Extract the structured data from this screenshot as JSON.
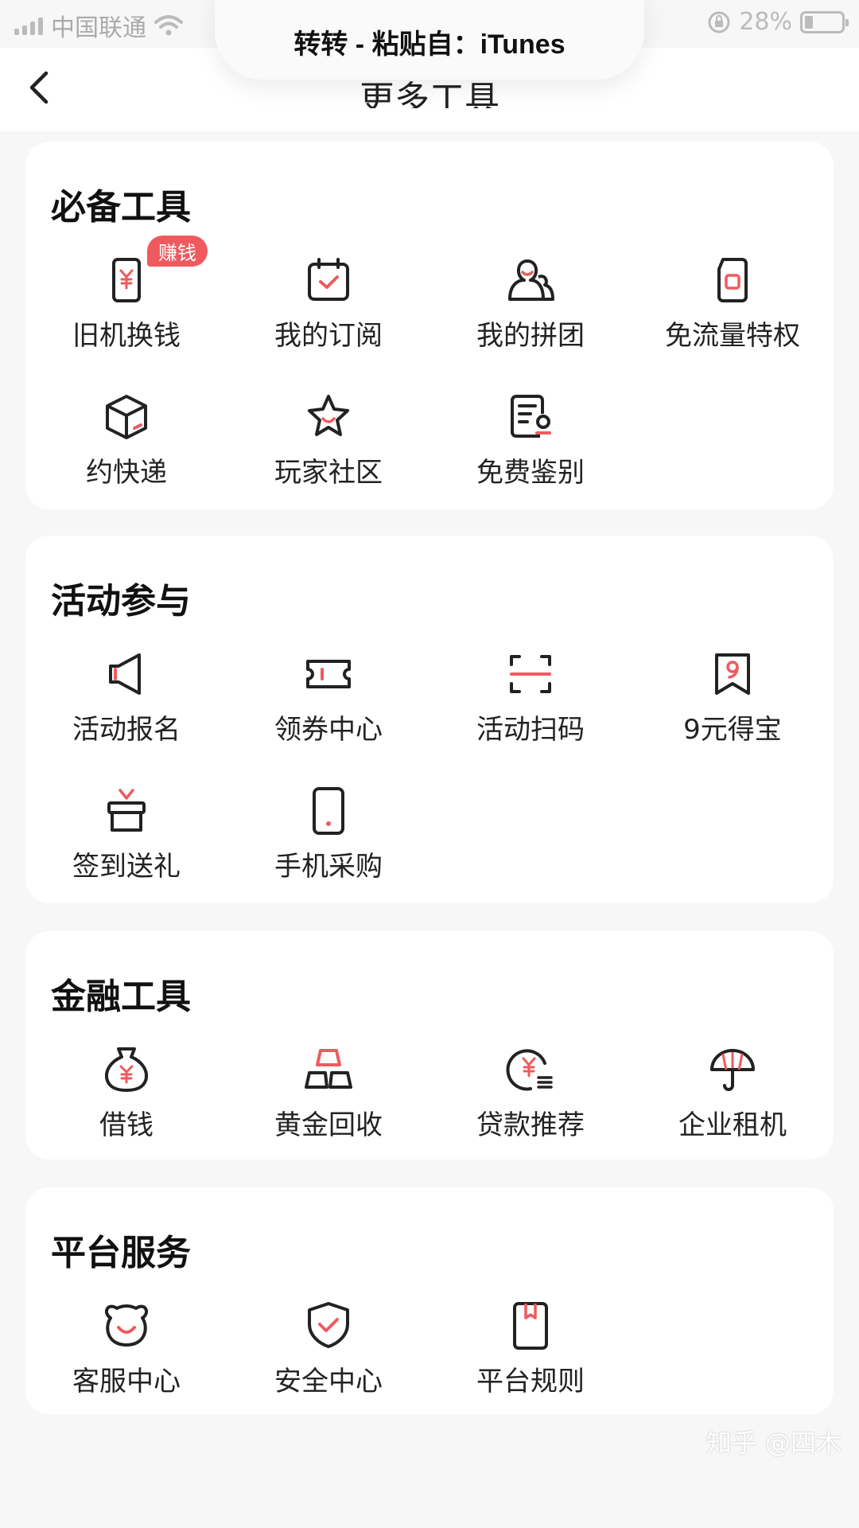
{
  "status_bar": {
    "carrier": "中国联通",
    "battery": "28%"
  },
  "banner": {
    "text": "转转 - 粘贴自：iTunes"
  },
  "nav": {
    "title": "更多工具"
  },
  "sections": [
    {
      "title": "必备工具",
      "items": [
        {
          "label": "旧机换钱",
          "icon": "phone-cash-icon",
          "badge": "赚钱"
        },
        {
          "label": "我的订阅",
          "icon": "calendar-check-icon"
        },
        {
          "label": "我的拼团",
          "icon": "group-users-icon"
        },
        {
          "label": "免流量特权",
          "icon": "sim-card-icon"
        },
        {
          "label": "约快递",
          "icon": "package-box-icon"
        },
        {
          "label": "玩家社区",
          "icon": "star-smile-icon"
        },
        {
          "label": "免费鉴别",
          "icon": "certificate-icon"
        }
      ]
    },
    {
      "title": "活动参与",
      "items": [
        {
          "label": "活动报名",
          "icon": "megaphone-icon"
        },
        {
          "label": "领券中心",
          "icon": "ticket-icon"
        },
        {
          "label": "活动扫码",
          "icon": "scan-icon"
        },
        {
          "label": "9元得宝",
          "icon": "nine-tag-icon"
        },
        {
          "label": "签到送礼",
          "icon": "gift-icon"
        },
        {
          "label": "手机采购",
          "icon": "mobile-phone-icon"
        }
      ]
    },
    {
      "title": "金融工具",
      "items": [
        {
          "label": "借钱",
          "icon": "money-bag-icon"
        },
        {
          "label": "黄金回收",
          "icon": "gold-bars-icon"
        },
        {
          "label": "贷款推荐",
          "icon": "loan-coin-icon"
        },
        {
          "label": "企业租机",
          "icon": "umbrella-icon"
        }
      ]
    },
    {
      "title": "平台服务",
      "items": [
        {
          "label": "客服中心",
          "icon": "bear-face-icon"
        },
        {
          "label": "安全中心",
          "icon": "shield-check-icon"
        },
        {
          "label": "平台规则",
          "icon": "rule-book-icon"
        }
      ]
    }
  ],
  "watermark": "知乎 @四木",
  "colors": {
    "accent": "#ef5a5f",
    "icon_stroke": "#222222",
    "background": "#f7f7f7"
  }
}
